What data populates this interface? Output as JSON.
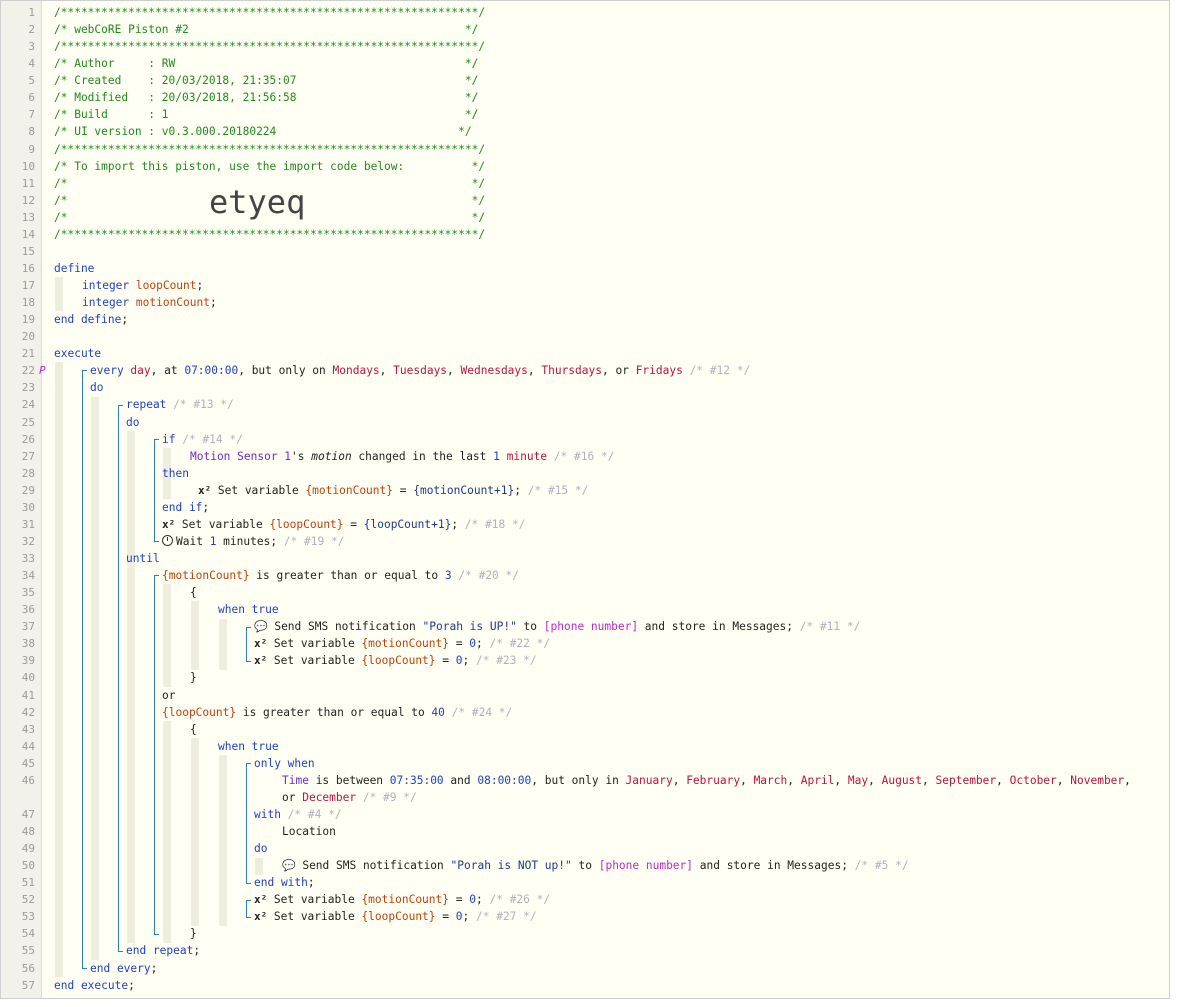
{
  "import_code": "etyeq",
  "lines": [
    {
      "n": "1",
      "indent": 0,
      "parts": [
        [
          "c",
          "/**************************************************************/"
        ]
      ]
    },
    {
      "n": "2",
      "indent": 0,
      "parts": [
        [
          "c",
          "/* webCoRE Piston #2                                         */"
        ]
      ]
    },
    {
      "n": "3",
      "indent": 0,
      "parts": [
        [
          "c",
          "/**************************************************************/"
        ]
      ]
    },
    {
      "n": "4",
      "indent": 0,
      "parts": [
        [
          "c",
          "/* Author     : RW                                           */"
        ]
      ]
    },
    {
      "n": "5",
      "indent": 0,
      "parts": [
        [
          "c",
          "/* Created    : 20/03/2018, 21:35:07                         */"
        ]
      ]
    },
    {
      "n": "6",
      "indent": 0,
      "parts": [
        [
          "c",
          "/* Modified   : 20/03/2018, 21:56:58                         */"
        ]
      ]
    },
    {
      "n": "7",
      "indent": 0,
      "parts": [
        [
          "c",
          "/* Build      : 1                                            */"
        ]
      ]
    },
    {
      "n": "8",
      "indent": 0,
      "parts": [
        [
          "c",
          "/* UI version : v0.3.000.20180224                           */"
        ]
      ]
    },
    {
      "n": "9",
      "indent": 0,
      "parts": [
        [
          "c",
          "/**************************************************************/"
        ]
      ]
    },
    {
      "n": "10",
      "indent": 0,
      "parts": [
        [
          "c",
          "/* To import this piston, use the import code below:          */"
        ]
      ]
    },
    {
      "n": "11",
      "indent": 0,
      "parts": [
        [
          "c",
          "/*                                                            */"
        ]
      ]
    },
    {
      "n": "12",
      "indent": 0,
      "parts": [
        [
          "c",
          "/*                                                            */"
        ]
      ]
    },
    {
      "n": "13",
      "indent": 0,
      "parts": [
        [
          "c",
          "/*                                                            */"
        ]
      ]
    },
    {
      "n": "14",
      "indent": 0,
      "parts": [
        [
          "c",
          "/**************************************************************/"
        ]
      ]
    },
    {
      "n": "15",
      "indent": 0,
      "parts": []
    },
    {
      "n": "16",
      "indent": 0,
      "parts": [
        [
          "k",
          "define"
        ]
      ]
    },
    {
      "n": "17",
      "indent": 81,
      "parts": [
        [
          "k",
          "integer "
        ],
        [
          "v",
          "loopCount"
        ],
        [
          "",
          ";"
        ]
      ]
    },
    {
      "n": "18",
      "indent": 81,
      "parts": [
        [
          "k",
          "integer "
        ],
        [
          "v",
          "motionCount"
        ],
        [
          "",
          ";"
        ]
      ]
    },
    {
      "n": "19",
      "indent": 0,
      "parts": [
        [
          "k",
          "end define"
        ],
        [
          "",
          ";"
        ]
      ]
    },
    {
      "n": "20",
      "indent": 0,
      "parts": []
    },
    {
      "n": "21",
      "indent": 0,
      "parts": [
        [
          "k",
          "execute"
        ]
      ]
    },
    {
      "n": "22",
      "indent": 89,
      "marker": "P",
      "parts": [
        [
          "k",
          "every "
        ],
        [
          "m",
          "day"
        ],
        [
          "",
          ", at "
        ],
        [
          "n",
          "07:00:00"
        ],
        [
          "",
          ", but only on "
        ],
        [
          "m",
          "Mondays"
        ],
        [
          "",
          ", "
        ],
        [
          "m",
          "Tuesdays"
        ],
        [
          "",
          ", "
        ],
        [
          "m",
          "Wednesdays"
        ],
        [
          "",
          ", "
        ],
        [
          "m",
          "Thursdays"
        ],
        [
          "",
          ", or "
        ],
        [
          "m",
          "Fridays"
        ],
        [
          "g",
          " /* #12 */"
        ]
      ]
    },
    {
      "n": "23",
      "indent": 89,
      "parts": [
        [
          "k",
          "do"
        ]
      ]
    },
    {
      "n": "24",
      "indent": 125,
      "parts": [
        [
          "k",
          "repeat"
        ],
        [
          "g",
          " /* #13 */"
        ]
      ]
    },
    {
      "n": "25",
      "indent": 125,
      "parts": [
        [
          "k",
          "do"
        ]
      ]
    },
    {
      "n": "26",
      "indent": 161,
      "parts": [
        [
          "k",
          "if"
        ],
        [
          "g",
          " /* #14 */"
        ]
      ]
    },
    {
      "n": "27",
      "indent": 189,
      "parts": [
        [
          "d",
          "Motion Sensor 1"
        ],
        [
          "",
          "'s "
        ],
        [
          "i",
          "motion"
        ],
        [
          "",
          " changed in the last "
        ],
        [
          "n",
          "1"
        ],
        [
          "",
          " "
        ],
        [
          "m",
          "minute"
        ],
        [
          "g",
          " /* #16 */"
        ]
      ]
    },
    {
      "n": "28",
      "indent": 161,
      "parts": [
        [
          "k",
          "then"
        ]
      ]
    },
    {
      "n": "29",
      "indent": 197,
      "parts": [
        [
          "x",
          "x² "
        ],
        [
          "",
          "Set variable "
        ],
        [
          "v",
          "{motionCount}"
        ],
        [
          "",
          " = "
        ],
        [
          "s",
          "{motionCount+1}"
        ],
        [
          "",
          "; "
        ],
        [
          "g",
          "/* #15 */"
        ]
      ]
    },
    {
      "n": "30",
      "indent": 161,
      "parts": [
        [
          "k",
          "end if"
        ],
        [
          "",
          ";"
        ]
      ]
    },
    {
      "n": "31",
      "indent": 161,
      "parts": [
        [
          "x",
          "x² "
        ],
        [
          "",
          "Set variable "
        ],
        [
          "v",
          "{loopCount}"
        ],
        [
          "",
          " = "
        ],
        [
          "s",
          "{loopCount+1}"
        ],
        [
          "",
          "; "
        ],
        [
          "g",
          "/* #18 */"
        ]
      ]
    },
    {
      "n": "32",
      "indent": 161,
      "parts": [
        [
          "clock",
          ""
        ],
        [
          "",
          "Wait "
        ],
        [
          "n",
          "1"
        ],
        [
          "",
          " minutes; "
        ],
        [
          "g",
          "/* #19 */"
        ]
      ]
    },
    {
      "n": "33",
      "indent": 125,
      "parts": [
        [
          "k",
          "until"
        ]
      ]
    },
    {
      "n": "34",
      "indent": 161,
      "parts": [
        [
          "v",
          "{motionCount}"
        ],
        [
          "",
          " is greater than or equal to "
        ],
        [
          "n",
          "3"
        ],
        [
          "g",
          " /* #20 */"
        ]
      ]
    },
    {
      "n": "35",
      "indent": 189,
      "parts": [
        [
          "",
          "{"
        ]
      ]
    },
    {
      "n": "36",
      "indent": 217,
      "parts": [
        [
          "k",
          "when true"
        ]
      ]
    },
    {
      "n": "37",
      "indent": 253,
      "parts": [
        [
          "x",
          "💬 "
        ],
        [
          "",
          "Send SMS notification "
        ],
        [
          "s",
          "\"Porah is UP!\""
        ],
        [
          "",
          " to "
        ],
        [
          "p",
          "[phone number]"
        ],
        [
          "",
          " and store in Messages; "
        ],
        [
          "g",
          "/* #11 */"
        ]
      ]
    },
    {
      "n": "38",
      "indent": 253,
      "parts": [
        [
          "x",
          "x² "
        ],
        [
          "",
          "Set variable "
        ],
        [
          "v",
          "{motionCount}"
        ],
        [
          "",
          " = "
        ],
        [
          "n",
          "0"
        ],
        [
          "",
          "; "
        ],
        [
          "g",
          "/* #22 */"
        ]
      ]
    },
    {
      "n": "39",
      "indent": 253,
      "parts": [
        [
          "x",
          "x² "
        ],
        [
          "",
          "Set variable "
        ],
        [
          "v",
          "{loopCount}"
        ],
        [
          "",
          " = "
        ],
        [
          "n",
          "0"
        ],
        [
          "",
          "; "
        ],
        [
          "g",
          "/* #23 */"
        ]
      ]
    },
    {
      "n": "40",
      "indent": 189,
      "parts": [
        [
          "",
          "}"
        ]
      ]
    },
    {
      "n": "41",
      "indent": 161,
      "parts": [
        [
          "",
          "or"
        ]
      ]
    },
    {
      "n": "42",
      "indent": 161,
      "parts": [
        [
          "v",
          "{loopCount}"
        ],
        [
          "",
          " is greater than or equal to "
        ],
        [
          "n",
          "40"
        ],
        [
          "g",
          " /* #24 */"
        ]
      ]
    },
    {
      "n": "43",
      "indent": 189,
      "parts": [
        [
          "",
          "{"
        ]
      ]
    },
    {
      "n": "44",
      "indent": 217,
      "parts": [
        [
          "k",
          "when true"
        ]
      ]
    },
    {
      "n": "45",
      "indent": 253,
      "parts": [
        [
          "k",
          "only when"
        ]
      ]
    },
    {
      "n": "46",
      "indent": 281,
      "wrap": true,
      "parts": [
        [
          "d",
          "Time"
        ],
        [
          "",
          " is between "
        ],
        [
          "n",
          "07:35:00"
        ],
        [
          "",
          " and "
        ],
        [
          "n",
          "08:00:00"
        ],
        [
          "",
          ", but only in "
        ],
        [
          "m",
          "January"
        ],
        [
          "",
          ", "
        ],
        [
          "m",
          "February"
        ],
        [
          "",
          ", "
        ],
        [
          "m",
          "March"
        ],
        [
          "",
          ", "
        ],
        [
          "m",
          "April"
        ],
        [
          "",
          ", "
        ],
        [
          "m",
          "May"
        ],
        [
          "",
          ", "
        ],
        [
          "m",
          "August"
        ],
        [
          "",
          ", "
        ],
        [
          "m",
          "September"
        ],
        [
          "",
          ", "
        ],
        [
          "m",
          "October"
        ],
        [
          "",
          ", "
        ],
        [
          "m",
          "November"
        ],
        [
          "",
          ", or "
        ],
        [
          "m",
          "December"
        ],
        [
          "g",
          " /* #9 */"
        ]
      ]
    },
    {
      "n": "47",
      "indent": 253,
      "parts": [
        [
          "k",
          "with"
        ],
        [
          "g",
          " /* #4 */"
        ]
      ]
    },
    {
      "n": "48",
      "indent": 281,
      "parts": [
        [
          "",
          "Location"
        ]
      ]
    },
    {
      "n": "49",
      "indent": 253,
      "parts": [
        [
          "k",
          "do"
        ]
      ]
    },
    {
      "n": "50",
      "indent": 281,
      "parts": [
        [
          "x",
          "💬 "
        ],
        [
          "",
          "Send SMS notification "
        ],
        [
          "s",
          "\"Porah is NOT up!\""
        ],
        [
          "",
          " to "
        ],
        [
          "p",
          "[phone number]"
        ],
        [
          "",
          " and store in Messages; "
        ],
        [
          "g",
          "/* #5 */"
        ]
      ]
    },
    {
      "n": "51",
      "indent": 253,
      "parts": [
        [
          "k",
          "end with"
        ],
        [
          "",
          ";"
        ]
      ]
    },
    {
      "n": "52",
      "indent": 253,
      "parts": [
        [
          "x",
          "x² "
        ],
        [
          "",
          "Set variable "
        ],
        [
          "v",
          "{motionCount}"
        ],
        [
          "",
          " = "
        ],
        [
          "n",
          "0"
        ],
        [
          "",
          "; "
        ],
        [
          "g",
          "/* #26 */"
        ]
      ]
    },
    {
      "n": "53",
      "indent": 253,
      "parts": [
        [
          "x",
          "x² "
        ],
        [
          "",
          "Set variable "
        ],
        [
          "v",
          "{loopCount}"
        ],
        [
          "",
          " = "
        ],
        [
          "n",
          "0"
        ],
        [
          "",
          "; "
        ],
        [
          "g",
          "/* #27 */"
        ]
      ]
    },
    {
      "n": "54",
      "indent": 189,
      "parts": [
        [
          "",
          "}"
        ]
      ]
    },
    {
      "n": "55",
      "indent": 125,
      "parts": [
        [
          "k",
          "end repeat"
        ],
        [
          "",
          ";"
        ]
      ]
    },
    {
      "n": "56",
      "indent": 89,
      "parts": [
        [
          "k",
          "end every"
        ],
        [
          "",
          ";"
        ]
      ]
    },
    {
      "n": "57",
      "indent": 53,
      "parts": [
        [
          "k",
          "end execute"
        ],
        [
          "",
          ";"
        ]
      ]
    }
  ]
}
